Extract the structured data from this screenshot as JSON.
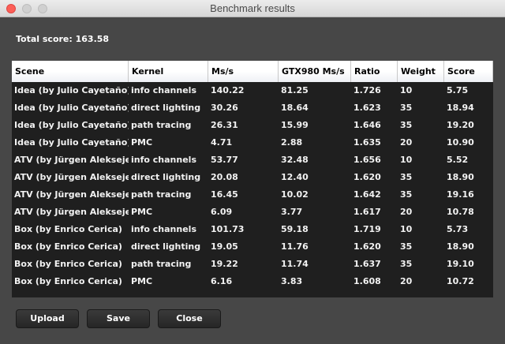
{
  "window": {
    "title": "Benchmark results"
  },
  "total_score": "Total score: 163.58",
  "table": {
    "headers": [
      "Scene",
      "Kernel",
      "Ms/s",
      "GTX980 Ms/s",
      "Ratio",
      "Weight",
      "Score"
    ],
    "rows": [
      [
        "Idea (by Julio Cayetaño)",
        "info channels",
        "140.22",
        "81.25",
        "1.726",
        "10",
        "5.75"
      ],
      [
        "Idea (by Julio Cayetaño)",
        "direct lighting",
        "30.26",
        "18.64",
        "1.623",
        "35",
        "18.94"
      ],
      [
        "Idea (by Julio Cayetaño)",
        "path tracing",
        "26.31",
        "15.99",
        "1.646",
        "35",
        "19.20"
      ],
      [
        "Idea (by Julio Cayetaño)",
        "PMC",
        "4.71",
        "2.88",
        "1.635",
        "20",
        "10.90"
      ],
      [
        "ATV (by Jürgen Aleksejev)",
        "info channels",
        "53.77",
        "32.48",
        "1.656",
        "10",
        "5.52"
      ],
      [
        "ATV (by Jürgen Aleksejev)",
        "direct lighting",
        "20.08",
        "12.40",
        "1.620",
        "35",
        "18.90"
      ],
      [
        "ATV (by Jürgen Aleksejev)",
        "path tracing",
        "16.45",
        "10.02",
        "1.642",
        "35",
        "19.16"
      ],
      [
        "ATV (by Jürgen Aleksejev)",
        "PMC",
        "6.09",
        "3.77",
        "1.617",
        "20",
        "10.78"
      ],
      [
        "Box (by Enrico Cerica)",
        "info channels",
        "101.73",
        "59.18",
        "1.719",
        "10",
        "5.73"
      ],
      [
        "Box (by Enrico Cerica)",
        "direct lighting",
        "19.05",
        "11.76",
        "1.620",
        "35",
        "18.90"
      ],
      [
        "Box (by Enrico Cerica)",
        "path tracing",
        "19.22",
        "11.74",
        "1.637",
        "35",
        "19.10"
      ],
      [
        "Box (by Enrico Cerica)",
        "PMC",
        "6.16",
        "3.83",
        "1.608",
        "20",
        "10.72"
      ]
    ]
  },
  "buttons": {
    "upload": "Upload",
    "save": "Save",
    "close": "Close"
  },
  "colors": {
    "close_light": "#fc5f57"
  }
}
